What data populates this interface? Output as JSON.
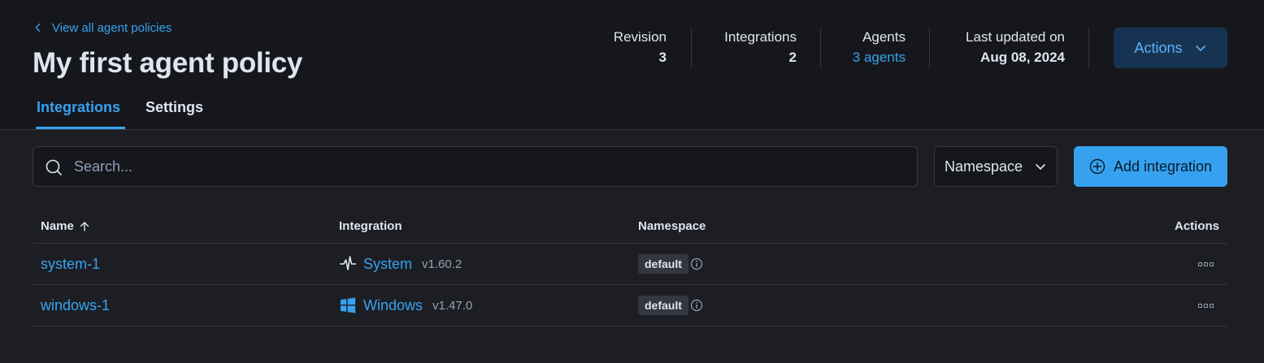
{
  "header": {
    "back_link": "View all agent policies",
    "title": "My first agent policy",
    "stats": {
      "revision_label": "Revision",
      "revision_value": "3",
      "integrations_label": "Integrations",
      "integrations_value": "2",
      "agents_label": "Agents",
      "agents_value": "3 agents",
      "updated_label": "Last updated on",
      "updated_value": "Aug 08, 2024"
    },
    "actions_label": "Actions"
  },
  "tabs": [
    {
      "label": "Integrations",
      "active": true
    },
    {
      "label": "Settings",
      "active": false
    }
  ],
  "toolbar": {
    "search_placeholder": "Search...",
    "namespace_label": "Namespace",
    "add_label": "Add integration"
  },
  "table": {
    "columns": [
      "Name",
      "Integration",
      "Namespace",
      "Actions"
    ],
    "sort": "Name ascending",
    "rows": [
      {
        "name": "system-1",
        "integration": "System",
        "version": "v1.60.2",
        "namespace": "default",
        "icon": "system-pulse-icon"
      },
      {
        "name": "windows-1",
        "integration": "Windows",
        "version": "v1.47.0",
        "namespace": "default",
        "icon": "windows-logo-icon"
      }
    ]
  },
  "colors": {
    "accent": "#36a2ef",
    "header_bg": "#16171c",
    "body_bg": "#1d1e24",
    "actions_bg": "#163451",
    "badge_bg": "#343741"
  }
}
